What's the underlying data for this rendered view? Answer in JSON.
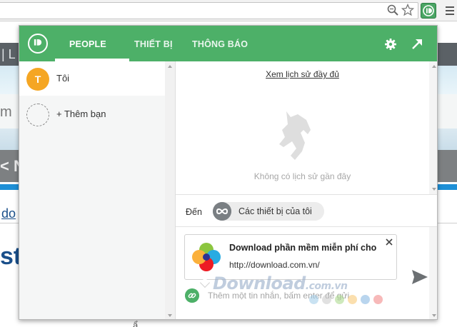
{
  "browser": {
    "icons": [
      "zoom-icon",
      "star-icon",
      "pushbullet-extension-icon",
      "chrome-menu-icon"
    ]
  },
  "background_page": {
    "text_1": "| L",
    "text_2": "m",
    "text_3": "< N",
    "text_4": "do",
    "text_5": "st",
    "text_6": "ẩ"
  },
  "popup": {
    "tabs": [
      {
        "label": "PEOPLE",
        "active": true
      },
      {
        "label": "THIẾT BỊ",
        "active": false
      },
      {
        "label": "THÔNG BÁO",
        "active": false
      }
    ],
    "icons": [
      "pushbullet-logo-icon",
      "gear-icon",
      "popout-icon"
    ],
    "contacts": [
      {
        "avatar": "T",
        "label": "Tôi",
        "active": true
      },
      {
        "avatar": "",
        "label": "+ Thêm bạn",
        "active": false
      }
    ],
    "history_link": "Xem lịch sử đầy đủ",
    "empty_text": "Không có lịch sử gần đây",
    "recipient": {
      "to_label": "Đến",
      "chip_label": "Các thiết bị của tôi"
    },
    "link_card": {
      "title": "Download phần mềm miễn phí cho",
      "url": "http://download.com.vn/"
    },
    "message_placeholder": "Thêm một tin nhắn, bấm enter để gửi",
    "colors": {
      "brand_green": "#4db068",
      "avatar_orange": "#f5a623"
    }
  },
  "watermark": {
    "text": "Download",
    "suffix": ".com.vn"
  }
}
